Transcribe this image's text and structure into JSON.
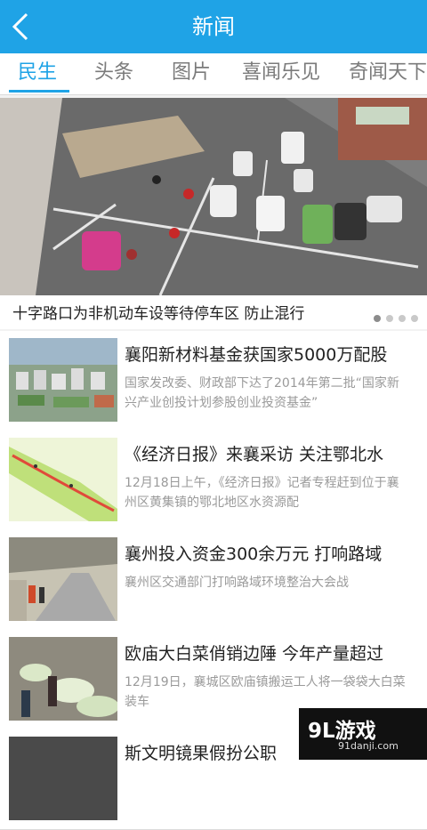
{
  "header": {
    "title": "新闻",
    "back_icon": "chevron-left-icon",
    "color": "#1fa3e6"
  },
  "tabs": [
    {
      "label": "民生",
      "active": true
    },
    {
      "label": "头条",
      "active": false
    },
    {
      "label": "图片",
      "active": false
    },
    {
      "label": "喜闻乐见",
      "active": false
    },
    {
      "label": "奇闻天下",
      "active": false
    }
  ],
  "hero": {
    "caption": "十字路口为非机动车设等待停车区 防止混行",
    "pages": 4,
    "current_page": 1
  },
  "news": [
    {
      "title": "襄阳新材料基金获国家5000万配股",
      "desc": "国家发改委、财政部下达了2014年第二批“国家新兴产业创投计划参股创业投资基金”"
    },
    {
      "title": "《经济日报》来襄采访 关注鄂北水",
      "desc": "12月18日上午，《经济日报》记者专程赶到位于襄州区黄集镇的鄂北地区水资源配"
    },
    {
      "title": "襄州投入资金300余万元 打响路域",
      "desc": "襄州区交通部门打响路域环境整治大会战"
    },
    {
      "title": "欧庙大白菜俏销边陲 今年产量超过",
      "desc": "12月19日，襄城区欧庙镇搬运工人将一袋袋大白菜装车"
    },
    {
      "title": "斯文明镜果假扮公职",
      "desc": ""
    }
  ],
  "watermark": {
    "logo": "9L游戏",
    "url": "91danji.com"
  }
}
